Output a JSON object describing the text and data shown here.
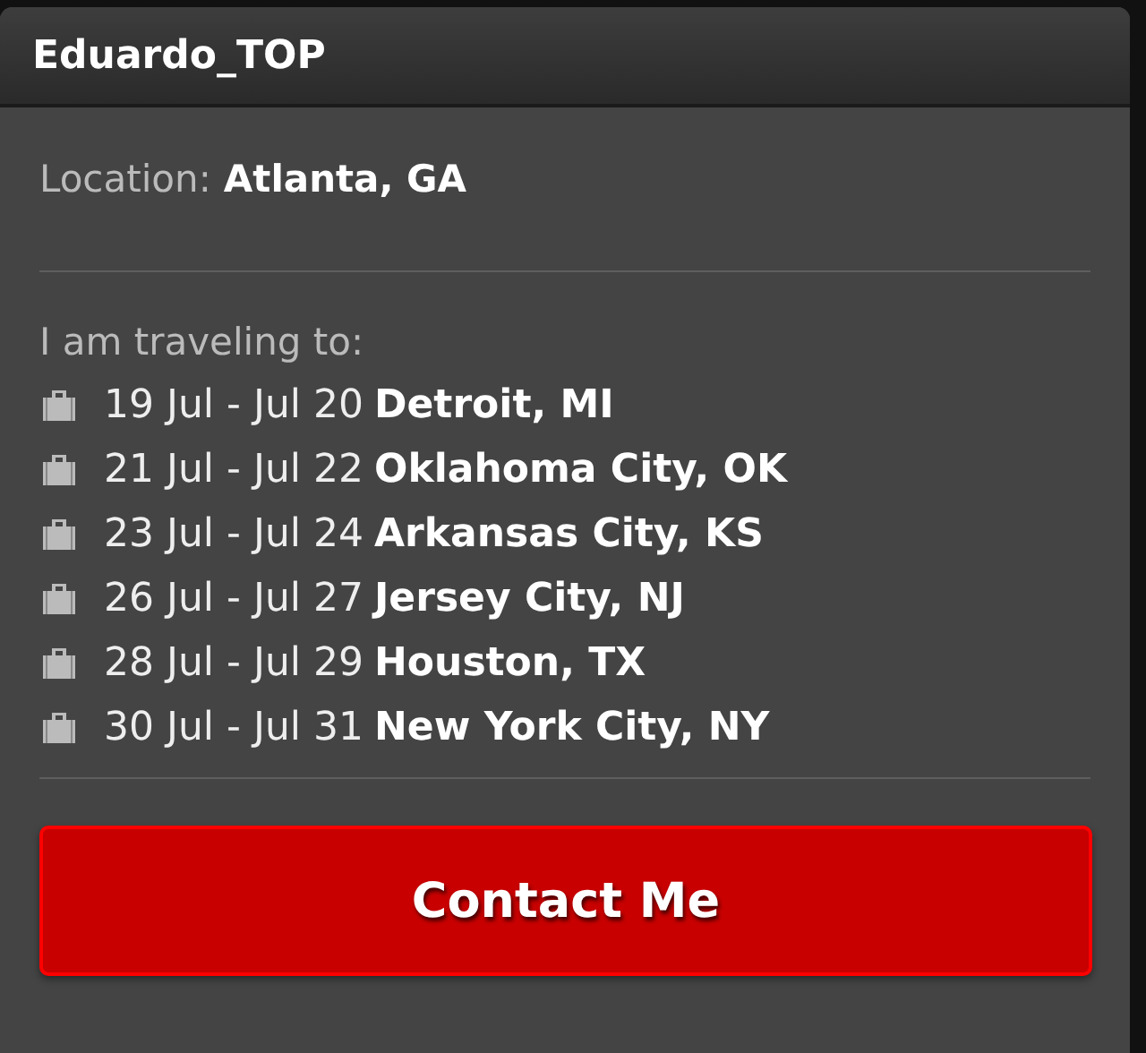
{
  "header": {
    "title": "Eduardo_TOP"
  },
  "location": {
    "label": "Location:",
    "value": "Atlanta, GA"
  },
  "trips_heading": "I am traveling to:",
  "trips": [
    {
      "dates": "19 Jul - Jul 20",
      "city": "Detroit, MI"
    },
    {
      "dates": "21 Jul - Jul 22",
      "city": "Oklahoma City, OK"
    },
    {
      "dates": "23 Jul - Jul 24",
      "city": "Arkansas City, KS"
    },
    {
      "dates": "26 Jul - Jul 27",
      "city": "Jersey City, NJ"
    },
    {
      "dates": "28 Jul - Jul 29",
      "city": "Houston, TX"
    },
    {
      "dates": "30 Jul - Jul 31",
      "city": "New York City, NY"
    }
  ],
  "button": {
    "label": "Contact Me"
  }
}
